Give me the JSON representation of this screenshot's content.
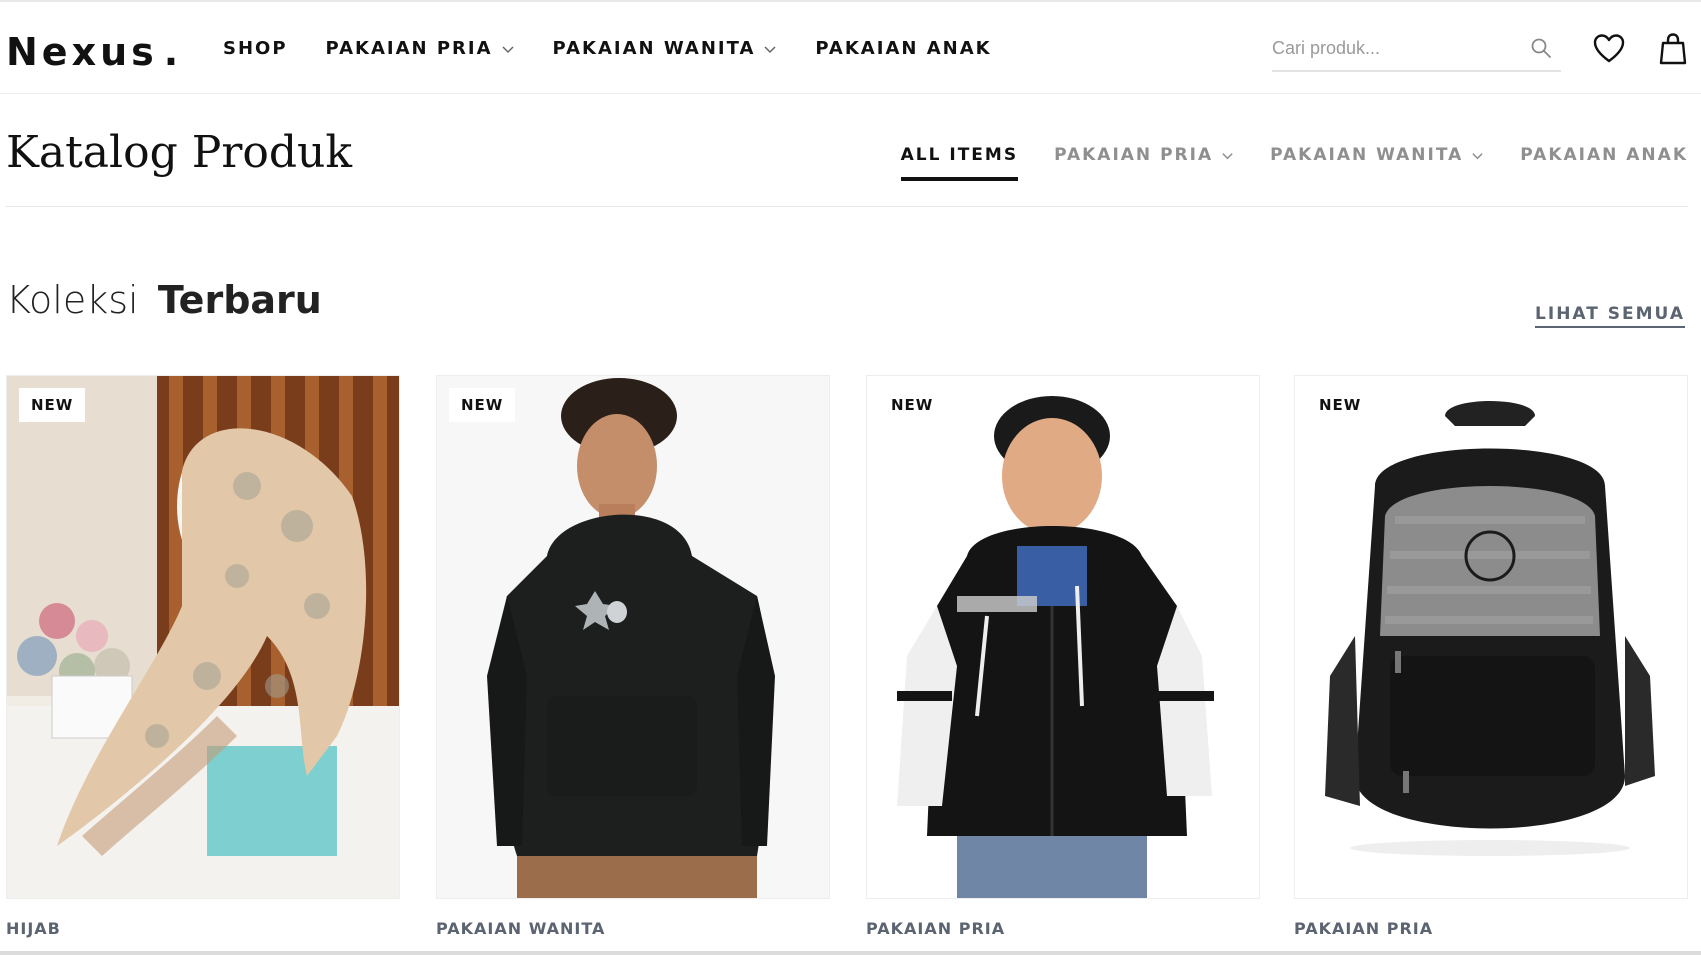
{
  "header": {
    "logo": "Nexus",
    "logo_dot": ".",
    "nav": [
      {
        "label": "SHOP",
        "has_dropdown": false
      },
      {
        "label": "PAKAIAN PRIA",
        "has_dropdown": true
      },
      {
        "label": "PAKAIAN WANITA",
        "has_dropdown": true
      },
      {
        "label": "PAKAIAN ANAK",
        "has_dropdown": false
      }
    ],
    "search_placeholder": "Cari produk...",
    "icons": [
      "search-icon",
      "heart-icon",
      "shopping-bag-icon"
    ]
  },
  "catalog": {
    "title": "Katalog Produk",
    "filters": [
      {
        "label": "ALL ITEMS",
        "active": true
      },
      {
        "label": "PAKAIAN PRIA",
        "has_dropdown": true
      },
      {
        "label": "PAKAIAN WANITA",
        "has_dropdown": true
      },
      {
        "label": "PAKAIAN ANAK"
      }
    ]
  },
  "collection": {
    "title_light": "Koleksi",
    "title_bold": "Terbaru",
    "see_all": "LIHAT SEMUA",
    "products": [
      {
        "badge": "NEW",
        "category": "HIJAB"
      },
      {
        "badge": "NEW",
        "category": "PAKAIAN WANITA"
      },
      {
        "badge": "NEW",
        "category": "PAKAIAN PRIA"
      },
      {
        "badge": "NEW",
        "category": "PAKAIAN PRIA"
      }
    ]
  },
  "colors": {
    "text": "#111111",
    "muted": "#8f8f8f",
    "category": "#5b6470"
  }
}
